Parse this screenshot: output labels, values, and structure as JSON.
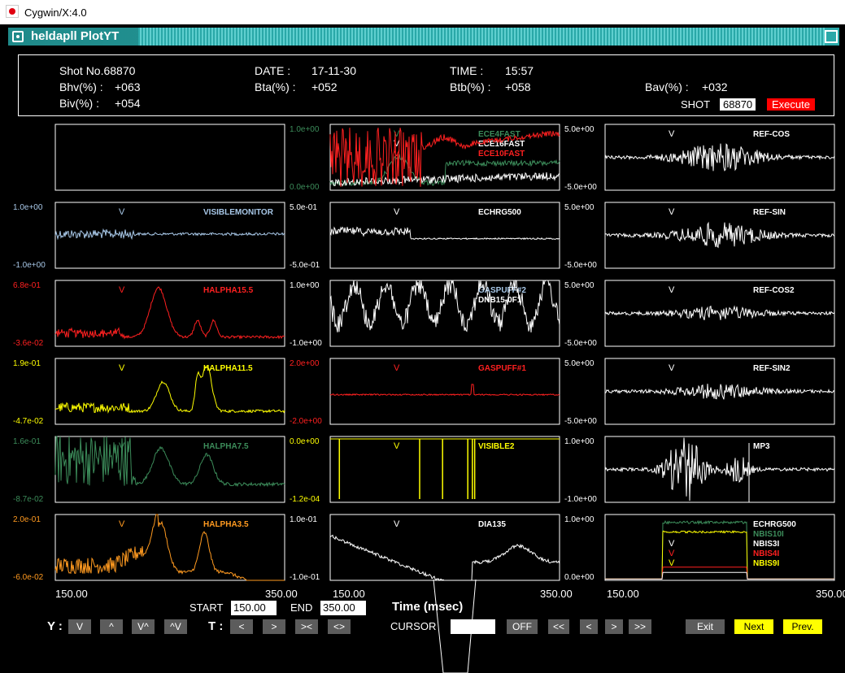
{
  "window": {
    "title": "Cygwin/X:4.0",
    "app_title": "heldapll PlotYT"
  },
  "header": {
    "shot_no": "Shot No.68870",
    "date_label": "DATE :",
    "date_value": "17-11-30",
    "time_label": "TIME :",
    "time_value": "15:57",
    "bhv_label": "Bhv(%) :",
    "bhv_value": "+063",
    "bta_label": "Bta(%) :",
    "bta_value": "+052",
    "btb_label": "Btb(%) :",
    "btb_value": "+058",
    "bav_label": "Bav(%) :",
    "bav_value": "+032",
    "biv_label": "Biv(%) :",
    "biv_value": "+054",
    "shot_label": "SHOT",
    "shot_input": "68870",
    "execute_label": "Execute"
  },
  "colors": {
    "accent_bar": "#2aa8a8",
    "execute": "#ff0000",
    "yellow_btn": "#ffff00",
    "btn": "#5c5c5c"
  },
  "panels": [
    {
      "id": "p00",
      "col": 0,
      "row": 0,
      "labels": [],
      "top": "",
      "bottom": "",
      "right_top": "1.0e+00",
      "right_bottom": "0.0e+00",
      "right_color": "#3c8c5a"
    },
    {
      "id": "p01",
      "col": 1,
      "row": 0,
      "labels": [
        {
          "text": "ECE4FAST",
          "color": "#3c8c5a",
          "v": "V"
        },
        {
          "text": "ECE16FAST",
          "color": "#ffffff",
          "v": "V"
        },
        {
          "text": "ECE10FAST",
          "color": "#ff2020",
          "v": "V"
        }
      ],
      "right_top": "5.0e+00",
      "right_bottom": "-5.0e+00",
      "right_color": "#ffffff"
    },
    {
      "id": "p02",
      "col": 2,
      "row": 0,
      "labels": [
        {
          "text": "REF-COS",
          "color": "#ffffff",
          "v": "V"
        }
      ]
    },
    {
      "id": "p10",
      "col": 0,
      "row": 1,
      "labels": [
        {
          "text": "VISIBLEMONITOR",
          "color": "#a8c8e8",
          "v": "V"
        }
      ],
      "left_top": "1.0e+00",
      "left_bottom": "-1.0e+00",
      "left_color": "#a8c8e8",
      "right_top": "5.0e-01",
      "right_bottom": "-5.0e-01",
      "right_color": "#ffffff"
    },
    {
      "id": "p11",
      "col": 1,
      "row": 1,
      "labels": [
        {
          "text": "ECHRG500",
          "color": "#ffffff",
          "v": "V"
        }
      ],
      "right_top": "5.0e+00",
      "right_bottom": "-5.0e+00",
      "right_color": "#ffffff"
    },
    {
      "id": "p12",
      "col": 2,
      "row": 1,
      "labels": [
        {
          "text": "REF-SIN",
          "color": "#ffffff",
          "v": "V"
        }
      ]
    },
    {
      "id": "p20",
      "col": 0,
      "row": 2,
      "labels": [
        {
          "text": "HALPHA15.5",
          "color": "#ff2020",
          "v": "V"
        }
      ],
      "left_top": "6.8e-01",
      "left_bottom": "-3.6e-02",
      "left_color": "#ff2020",
      "right_top": "1.0e+00",
      "right_bottom": "-1.0e+00",
      "right_color": "#ffffff"
    },
    {
      "id": "p21",
      "col": 1,
      "row": 2,
      "labels": [
        {
          "text": "GASPUFF#2",
          "color": "#a8c8e8",
          "v": ""
        },
        {
          "text": "DNB15-0F1",
          "color": "#ffffff",
          "v": ""
        }
      ],
      "right_top": "5.0e+00",
      "right_bottom": "-5.0e+00",
      "right_color": "#ffffff"
    },
    {
      "id": "p22",
      "col": 2,
      "row": 2,
      "labels": [
        {
          "text": "REF-COS2",
          "color": "#ffffff",
          "v": "V"
        }
      ]
    },
    {
      "id": "p30",
      "col": 0,
      "row": 3,
      "labels": [
        {
          "text": "HALPHA11.5",
          "color": "#ffff00",
          "v": "V"
        }
      ],
      "left_top": "1.9e-01",
      "left_bottom": "-4.7e-02",
      "left_color": "#ffff00",
      "right_top": "2.0e+00",
      "right_bottom": "-2.0e+00",
      "right_color": "#ff2020"
    },
    {
      "id": "p31",
      "col": 1,
      "row": 3,
      "labels": [
        {
          "text": "GASPUFF#1",
          "color": "#ff2020",
          "v": "V"
        }
      ],
      "right_top": "5.0e+00",
      "right_bottom": "-5.0e+00",
      "right_color": "#ffffff"
    },
    {
      "id": "p32",
      "col": 2,
      "row": 3,
      "labels": [
        {
          "text": "REF-SIN2",
          "color": "#ffffff",
          "v": "V"
        }
      ]
    },
    {
      "id": "p40",
      "col": 0,
      "row": 4,
      "labels": [
        {
          "text": "HALPHA7.5",
          "color": "#3c8c5a",
          "v": "V"
        }
      ],
      "left_top": "1.6e-01",
      "left_bottom": "-8.7e-02",
      "left_color": "#3c8c5a",
      "right_top": "0.0e+00",
      "right_bottom": "-1.2e-04",
      "right_color": "#ffff00"
    },
    {
      "id": "p41",
      "col": 1,
      "row": 4,
      "labels": [
        {
          "text": "VISIBLE2",
          "color": "#ffff00",
          "v": "V"
        }
      ],
      "right_top": "1.0e+00",
      "right_bottom": "-1.0e+00",
      "right_color": "#ffffff"
    },
    {
      "id": "p42",
      "col": 2,
      "row": 4,
      "labels": [
        {
          "text": "MP3",
          "color": "#ffffff",
          "v": ""
        }
      ]
    },
    {
      "id": "p50",
      "col": 0,
      "row": 5,
      "labels": [
        {
          "text": "HALPHA3.5",
          "color": "#ff9a20",
          "v": "V"
        }
      ],
      "left_top": "2.0e-01",
      "left_bottom": "-6.0e-02",
      "left_color": "#ff9a20",
      "right_top": "1.0e-01",
      "right_bottom": "-1.0e-01",
      "right_color": "#ffffff"
    },
    {
      "id": "p51",
      "col": 1,
      "row": 5,
      "labels": [
        {
          "text": "DIA135",
          "color": "#ffffff",
          "v": "V"
        }
      ],
      "right_top": "1.0e+00",
      "right_bottom": "0.0e+00",
      "right_color": "#ffffff"
    },
    {
      "id": "p52",
      "col": 2,
      "row": 5,
      "labels": [
        {
          "text": "ECHRG500",
          "color": "#ffffff",
          "v": ""
        },
        {
          "text": "NBIS10I",
          "color": "#3c8c5a",
          "v": ""
        },
        {
          "text": "NBIS3I",
          "color": "#ffffff",
          "v": "V"
        },
        {
          "text": "NBIS4I",
          "color": "#ff2020",
          "v": "V"
        },
        {
          "text": "NBIS9I",
          "color": "#ffff00",
          "v": "V"
        }
      ]
    }
  ],
  "axis": {
    "xmin": "150.00",
    "xmax": "350.00"
  },
  "controls": {
    "start_label": "START",
    "start_value": "150.00",
    "end_label": "END",
    "end_value": "350.00",
    "time_label": "Time (msec)",
    "y_label": "Y :",
    "y_buttons": [
      "V",
      "^",
      "V^",
      "^V"
    ],
    "t_label": "T :",
    "t_buttons": [
      "<",
      ">",
      "><",
      "<>"
    ],
    "cursor_label": "CURSOR",
    "cursor_value": "",
    "off_label": "OFF",
    "nav_buttons": [
      "<<",
      "<",
      ">",
      ">>"
    ],
    "exit_label": "Exit",
    "next_label": "Next",
    "prev_label": "Prev."
  }
}
